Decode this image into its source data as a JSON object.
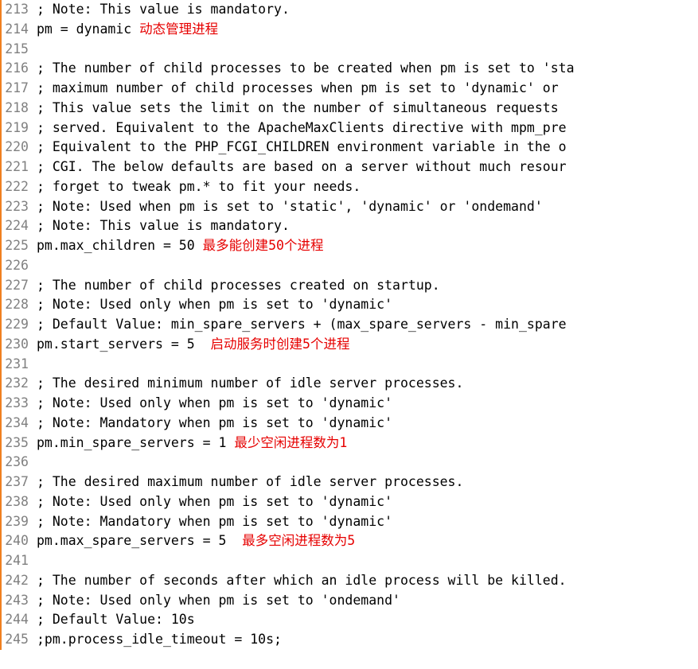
{
  "lines": [
    {
      "n": "213",
      "c": "; Note: This value is mandatory."
    },
    {
      "n": "214",
      "c": "pm = dynamic ",
      "a": "动态管理进程"
    },
    {
      "n": "215",
      "c": ""
    },
    {
      "n": "216",
      "c": "; The number of child processes to be created when pm is set to 'sta"
    },
    {
      "n": "217",
      "c": "; maximum number of child processes when pm is set to 'dynamic' or "
    },
    {
      "n": "218",
      "c": "; This value sets the limit on the number of simultaneous requests "
    },
    {
      "n": "219",
      "c": "; served. Equivalent to the ApacheMaxClients directive with mpm_pre"
    },
    {
      "n": "220",
      "c": "; Equivalent to the PHP_FCGI_CHILDREN environment variable in the o"
    },
    {
      "n": "221",
      "c": "; CGI. The below defaults are based on a server without much resour"
    },
    {
      "n": "222",
      "c": "; forget to tweak pm.* to fit your needs."
    },
    {
      "n": "223",
      "c": "; Note: Used when pm is set to 'static', 'dynamic' or 'ondemand'"
    },
    {
      "n": "224",
      "c": "; Note: This value is mandatory."
    },
    {
      "n": "225",
      "c": "pm.max_children = 50 ",
      "a": "最多能创建50个进程"
    },
    {
      "n": "226",
      "c": ""
    },
    {
      "n": "227",
      "c": "; The number of child processes created on startup."
    },
    {
      "n": "228",
      "c": "; Note: Used only when pm is set to 'dynamic'"
    },
    {
      "n": "229",
      "c": "; Default Value: min_spare_servers + (max_spare_servers - min_spare"
    },
    {
      "n": "230",
      "c": "pm.start_servers = 5  ",
      "a": "启动服务时创建5个进程"
    },
    {
      "n": "231",
      "c": ""
    },
    {
      "n": "232",
      "c": "; The desired minimum number of idle server processes."
    },
    {
      "n": "233",
      "c": "; Note: Used only when pm is set to 'dynamic'"
    },
    {
      "n": "234",
      "c": "; Note: Mandatory when pm is set to 'dynamic'"
    },
    {
      "n": "235",
      "c": "pm.min_spare_servers = 1 ",
      "a": "最少空闲进程数为1"
    },
    {
      "n": "236",
      "c": ""
    },
    {
      "n": "237",
      "c": "; The desired maximum number of idle server processes."
    },
    {
      "n": "238",
      "c": "; Note: Used only when pm is set to 'dynamic'"
    },
    {
      "n": "239",
      "c": "; Note: Mandatory when pm is set to 'dynamic'"
    },
    {
      "n": "240",
      "c": "pm.max_spare_servers = 5  ",
      "a": "最多空闲进程数为5"
    },
    {
      "n": "241",
      "c": ""
    },
    {
      "n": "242",
      "c": "; The number of seconds after which an idle process will be killed."
    },
    {
      "n": "243",
      "c": "; Note: Used only when pm is set to 'ondemand'"
    },
    {
      "n": "244",
      "c": "; Default Value: 10s"
    },
    {
      "n": "245",
      "c": ";pm.process_idle_timeout = 10s;"
    }
  ]
}
